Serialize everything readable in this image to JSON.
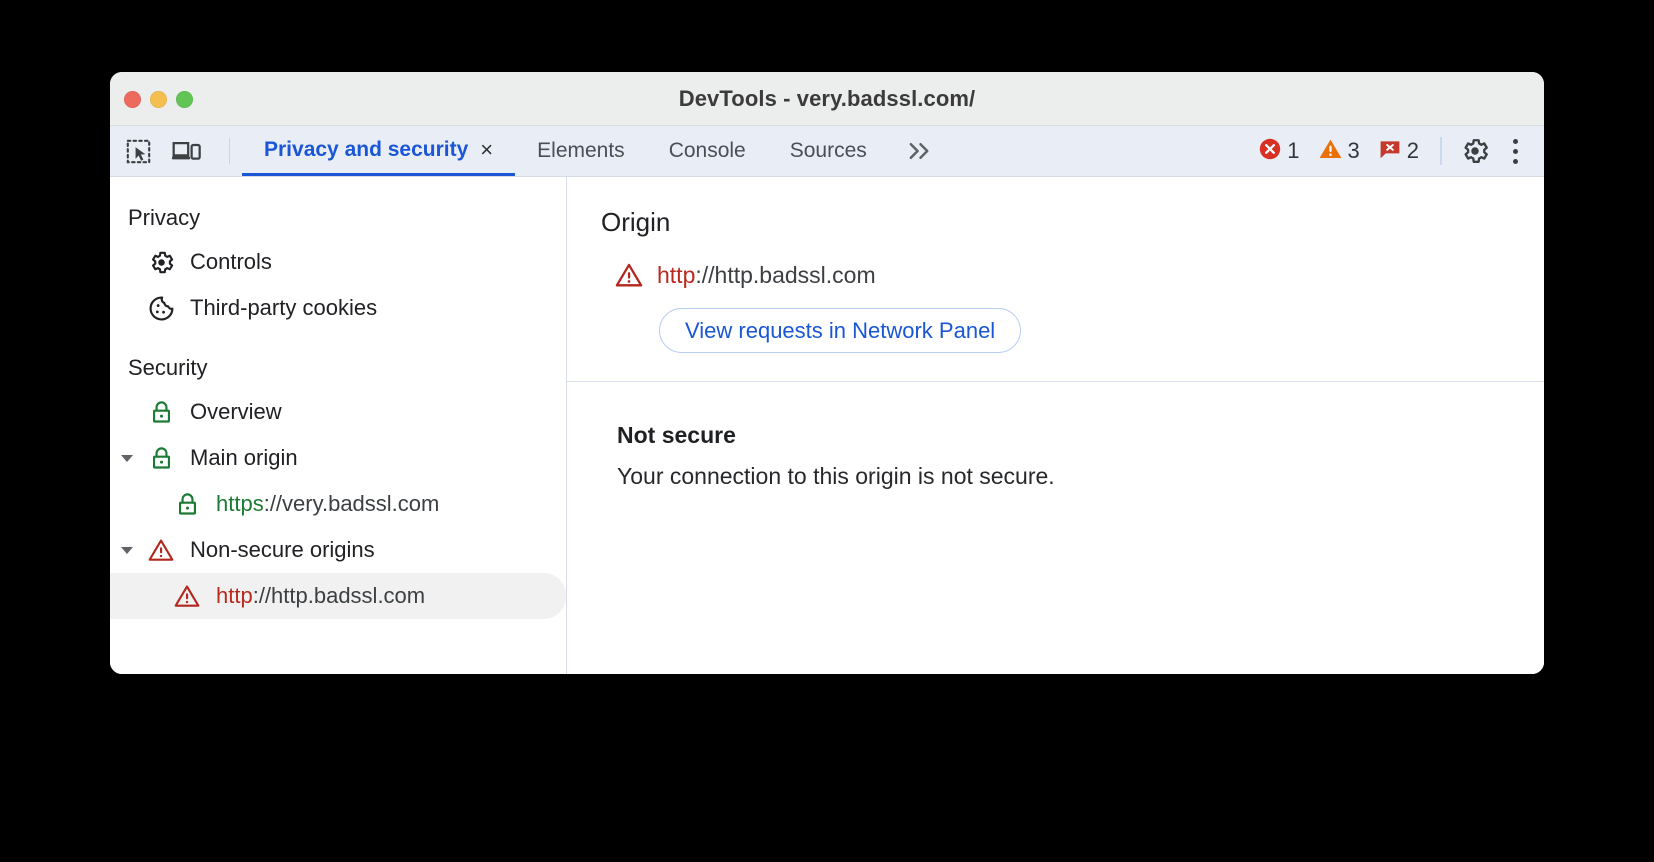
{
  "window": {
    "title": "DevTools - very.badssl.com/",
    "controls": [
      "close",
      "minimize",
      "maximize"
    ]
  },
  "toolbar": {
    "left_icons": [
      {
        "name": "inspect-element-icon",
        "label": "Inspect element"
      },
      {
        "name": "device-toolbar-icon",
        "label": "Toggle device toolbar"
      }
    ],
    "tabs": [
      {
        "label": "Privacy and security",
        "active": true,
        "closable": true,
        "close_label": "×"
      },
      {
        "label": "Elements",
        "active": false,
        "closable": false
      },
      {
        "label": "Console",
        "active": false,
        "closable": false
      },
      {
        "label": "Sources",
        "active": false,
        "closable": false
      }
    ],
    "overflow_label": "»",
    "badges": [
      {
        "name": "error-count",
        "icon": "error-circle-icon",
        "count": "1",
        "color": "#d93025"
      },
      {
        "name": "warning-count",
        "icon": "warning-triangle-icon",
        "count": "3",
        "color": "#e8710a"
      },
      {
        "name": "issue-count",
        "icon": "issue-message-icon",
        "count": "2",
        "color": "#c5392c"
      }
    ],
    "settings_label": "Settings",
    "more_label": "More options"
  },
  "sidebar": {
    "sections": [
      {
        "title": "Privacy",
        "items": [
          {
            "label": "Controls",
            "icon": "gear-icon",
            "indent": 1,
            "selected": false,
            "twisty": false
          },
          {
            "label": "Third-party cookies",
            "icon": "cookie-icon",
            "indent": 1,
            "selected": false,
            "twisty": false
          }
        ]
      },
      {
        "title": "Security",
        "items": [
          {
            "label": "Overview",
            "icon": "lock-green-icon",
            "indent": 1,
            "selected": false,
            "twisty": false
          },
          {
            "label": "Main origin",
            "icon": "lock-green-icon",
            "indent": 0,
            "selected": false,
            "twisty": true
          },
          {
            "label": "https://very.badssl.com",
            "scheme": "https",
            "rest": "://very.badssl.com",
            "scheme_color": "green",
            "icon": "lock-green-icon",
            "indent": 2,
            "selected": false,
            "twisty": false
          },
          {
            "label": "Non-secure origins",
            "icon": "warning-triangle-red-icon",
            "indent": 0,
            "selected": false,
            "twisty": true
          },
          {
            "label": "http://http.badssl.com",
            "scheme": "http",
            "rest": "://http.badssl.com",
            "scheme_color": "red",
            "icon": "warning-triangle-red-icon",
            "indent": 2,
            "selected": true,
            "twisty": false
          }
        ]
      }
    ]
  },
  "main": {
    "origin_heading": "Origin",
    "origin_scheme": "http",
    "origin_rest": "://http.badssl.com",
    "origin_icon": "warning-triangle-red-icon",
    "network_button_label": "View requests in Network Panel",
    "summary_title": "Not secure",
    "summary_text": "Your connection to this origin is not secure."
  },
  "colors": {
    "accent_blue": "#1a56d6",
    "error_red": "#bb2a1f",
    "secure_green": "#1b7a33",
    "warning_orange": "#e8710a",
    "tabbar_bg": "#e9eef6",
    "titlebar_bg": "#eceded",
    "selected_row_bg": "#f1f1f1"
  }
}
